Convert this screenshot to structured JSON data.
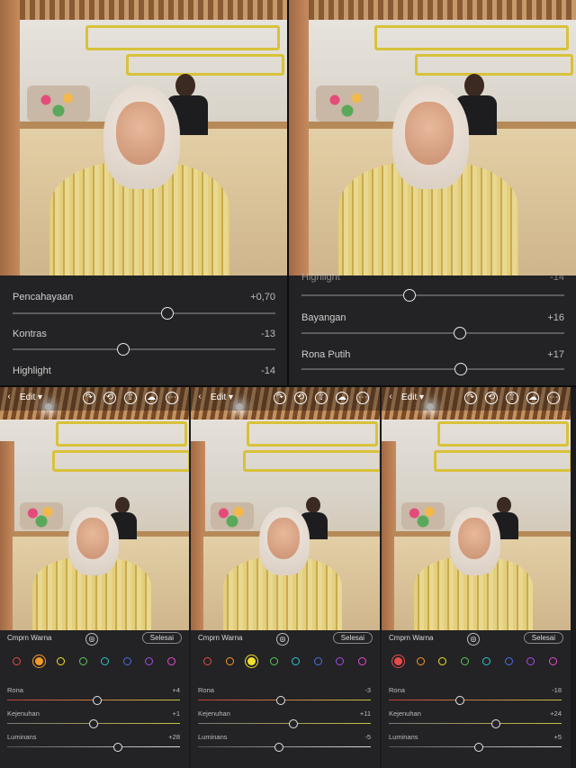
{
  "top_left": {
    "sliders": [
      {
        "label": "Pencahayaan",
        "value": "+0,70",
        "pos": 0.7
      },
      {
        "label": "Kontras",
        "value": "-13",
        "pos": 0.47
      },
      {
        "label": "Highlight",
        "value": "-14",
        "pos": 0.46
      }
    ]
  },
  "top_right": {
    "partial_label": "Highlight",
    "partial_value": "-14",
    "sliders": [
      {
        "label": "Bayangan",
        "value": "+16",
        "pos": 0.58
      },
      {
        "label": "Rona Putih",
        "value": "+17",
        "pos": 0.59
      }
    ]
  },
  "screens": [
    {
      "toolbar": {
        "edit_label": "Edit"
      },
      "compare_label": "Cmprn Warna",
      "done_label": "Selesai",
      "selected_color": "#f29a2a",
      "sliders": [
        {
          "label": "Rona",
          "value": "+4",
          "pos": 0.52
        },
        {
          "label": "Kejenuhan",
          "value": "+1",
          "pos": 0.5
        },
        {
          "label": "Luminans",
          "value": "+28",
          "pos": 0.64
        }
      ]
    },
    {
      "toolbar": {
        "edit_label": "Edit"
      },
      "compare_label": "Cmprn Warna",
      "done_label": "Selesai",
      "selected_color": "#f2e12a",
      "sliders": [
        {
          "label": "Rona",
          "value": "-3",
          "pos": 0.48
        },
        {
          "label": "Kejenuhan",
          "value": "+11",
          "pos": 0.55
        },
        {
          "label": "Luminans",
          "value": "-5",
          "pos": 0.47
        }
      ]
    },
    {
      "toolbar": {
        "edit_label": "Edit"
      },
      "compare_label": "Cmprn Warna",
      "done_label": "Selesai",
      "selected_color": "#e83a3a",
      "sliders": [
        {
          "label": "Rona",
          "value": "-18",
          "pos": 0.41
        },
        {
          "label": "Kejenuhan",
          "value": "+24",
          "pos": 0.62
        },
        {
          "label": "Luminans",
          "value": "+5",
          "pos": 0.52
        }
      ]
    }
  ],
  "color_dots": [
    "#e84a4a",
    "#f29a2a",
    "#f2e12a",
    "#59c959",
    "#2ac9c9",
    "#4a6ee8",
    "#a64ae8",
    "#e84ad6"
  ],
  "track_gradients": {
    "rona": [
      "#c44040",
      "#c9c040"
    ],
    "kejenuhan": [
      "#777777",
      "#c9c040"
    ],
    "luminans": [
      "#555555",
      "#dddddd"
    ]
  }
}
